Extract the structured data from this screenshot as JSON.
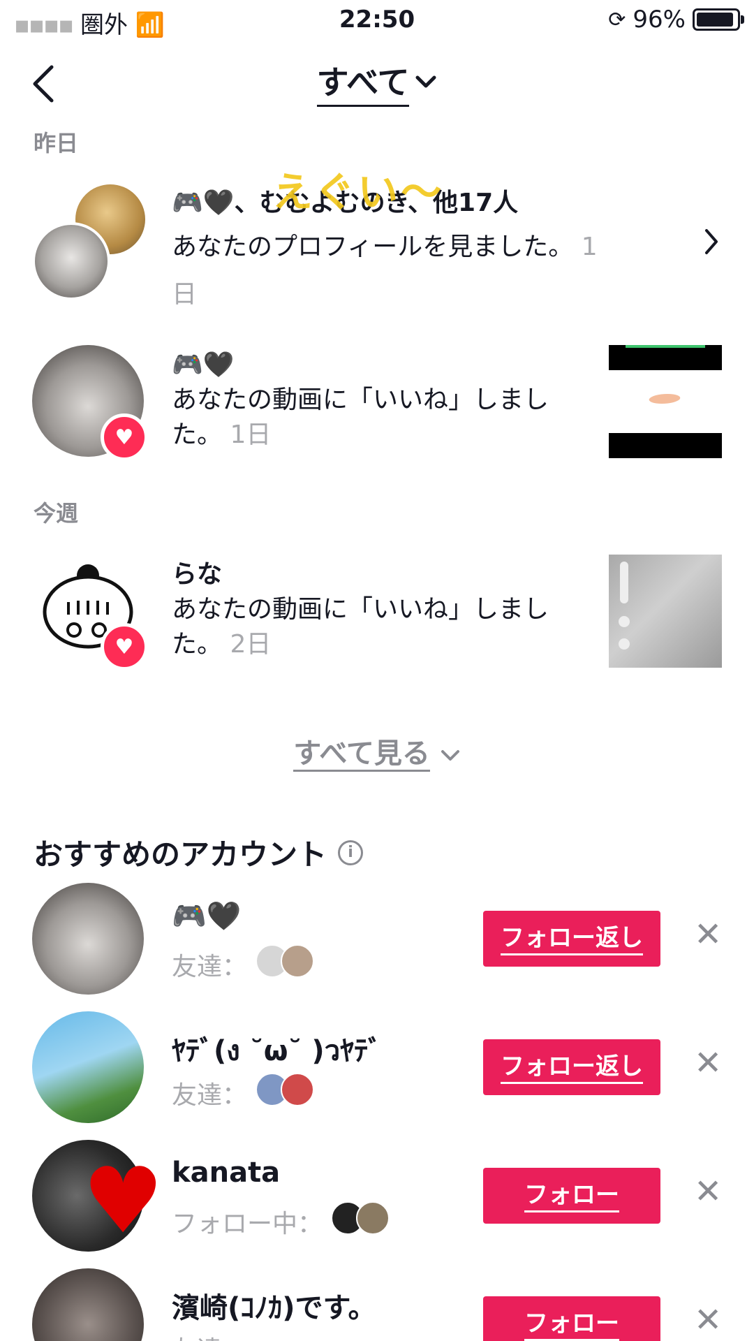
{
  "status_bar": {
    "carrier": "圏外",
    "time": "22:50",
    "battery": "96%"
  },
  "header": {
    "title": "すべて"
  },
  "sections": {
    "yesterday": "昨日",
    "this_week": "今週"
  },
  "notifications": [
    {
      "name": "🎮🖤、むむよむのき、他17人",
      "overlay_text": "えぐい〜",
      "message": "あなたのプロフィールを見ました。",
      "time": "1日"
    },
    {
      "name": "🎮🖤",
      "message": "あなたの動画に「いいね」しました。",
      "time": "1日"
    },
    {
      "name": "らな",
      "message": "あなたの動画に「いいね」しました。",
      "time": "2日"
    }
  ],
  "see_all": "すべて見る",
  "recommended": {
    "title": "おすすめのアカウント",
    "items": [
      {
        "name": "🎮🖤",
        "sub": "友達：",
        "button": "フォロー返し"
      },
      {
        "name": "ﾔﾃﾞ(ง ˘ω˘ )วﾔﾃﾞ",
        "sub": "友達：",
        "button": "フォロー返し"
      },
      {
        "name": "kanata",
        "sub": "フォロー中：",
        "button": "フォロー"
      },
      {
        "name": "濱崎(ｺﾉｶ)です。",
        "sub": "友達：",
        "button": "フォロー"
      }
    ]
  },
  "colors": {
    "accent": "#ea1f5a",
    "like_badge": "#fe2c55",
    "muted": "#8a8b91"
  }
}
